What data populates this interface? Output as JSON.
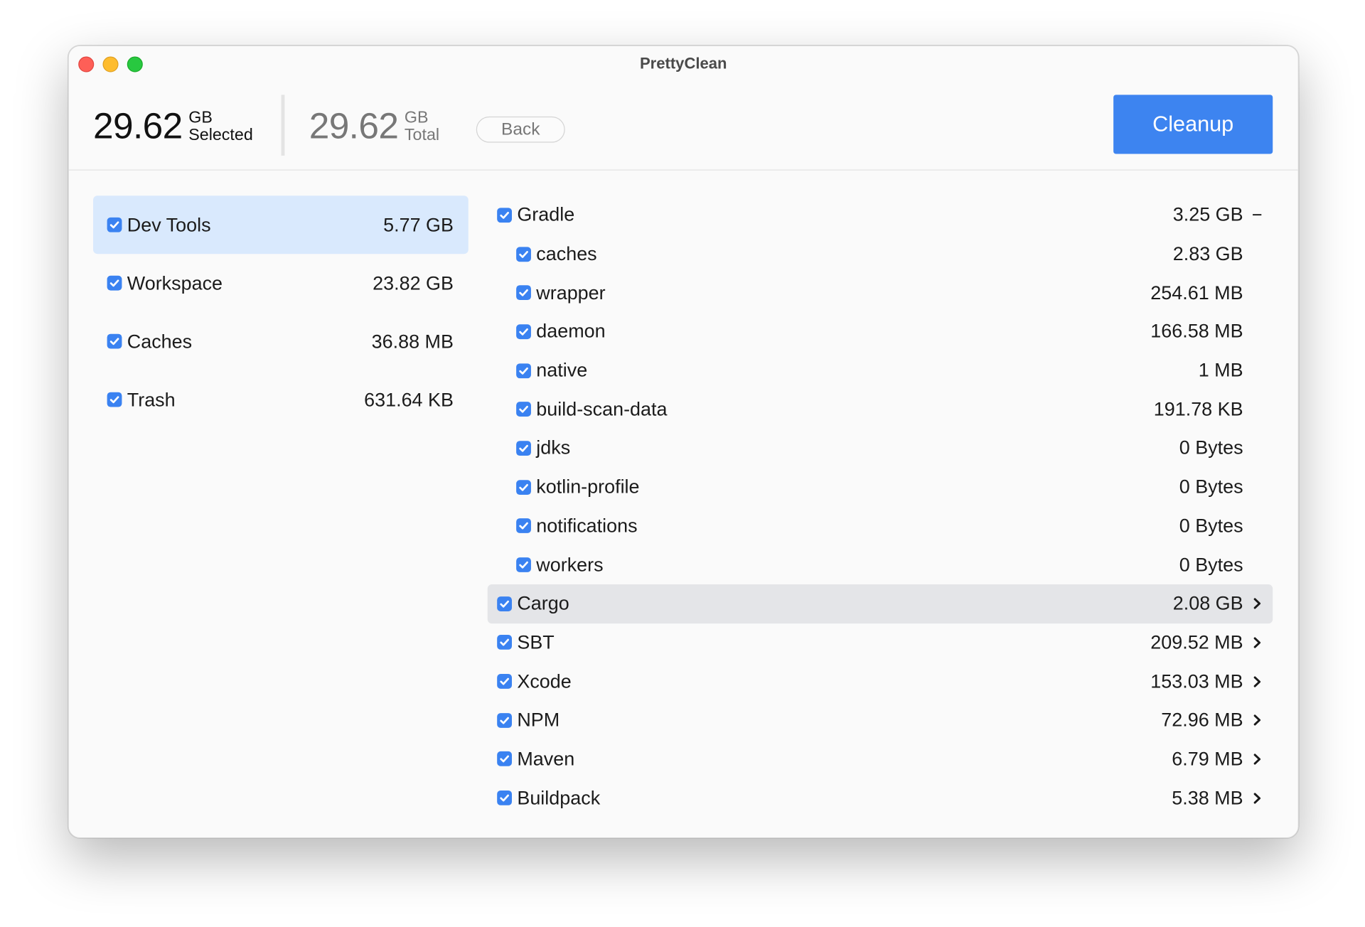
{
  "window": {
    "title": "PrettyClean"
  },
  "header": {
    "selected": {
      "value": "29.62",
      "unit": "GB",
      "caption": "Selected"
    },
    "total": {
      "value": "29.62",
      "unit": "GB",
      "caption": "Total"
    },
    "back_label": "Back",
    "cleanup_label": "Cleanup"
  },
  "categories": [
    {
      "label": "Dev Tools",
      "size": "5.77 GB",
      "checked": true,
      "active": true
    },
    {
      "label": "Workspace",
      "size": "23.82 GB",
      "checked": true,
      "active": false
    },
    {
      "label": "Caches",
      "size": "36.88 MB",
      "checked": true,
      "active": false
    },
    {
      "label": "Trash",
      "size": "631.64 KB",
      "checked": true,
      "active": false
    }
  ],
  "tools": [
    {
      "label": "Gradle",
      "size": "3.25 GB",
      "level": 0,
      "checked": true,
      "trail": "collapse-icon"
    },
    {
      "label": "caches",
      "size": "2.83 GB",
      "level": 1,
      "checked": true
    },
    {
      "label": "wrapper",
      "size": "254.61 MB",
      "level": 1,
      "checked": true
    },
    {
      "label": "daemon",
      "size": "166.58 MB",
      "level": 1,
      "checked": true
    },
    {
      "label": "native",
      "size": "1 MB",
      "level": 1,
      "checked": true
    },
    {
      "label": "build-scan-data",
      "size": "191.78 KB",
      "level": 1,
      "checked": true
    },
    {
      "label": "jdks",
      "size": "0 Bytes",
      "level": 1,
      "checked": true
    },
    {
      "label": "kotlin-profile",
      "size": "0 Bytes",
      "level": 1,
      "checked": true
    },
    {
      "label": "notifications",
      "size": "0 Bytes",
      "level": 1,
      "checked": true
    },
    {
      "label": "workers",
      "size": "0 Bytes",
      "level": 1,
      "checked": true
    },
    {
      "label": "Cargo",
      "size": "2.08 GB",
      "level": 0,
      "checked": true,
      "trail": "chevron-right-icon",
      "highlight": true
    },
    {
      "label": "SBT",
      "size": "209.52 MB",
      "level": 0,
      "checked": true,
      "trail": "chevron-right-icon"
    },
    {
      "label": "Xcode",
      "size": "153.03 MB",
      "level": 0,
      "checked": true,
      "trail": "chevron-right-icon"
    },
    {
      "label": "NPM",
      "size": "72.96 MB",
      "level": 0,
      "checked": true,
      "trail": "chevron-right-icon"
    },
    {
      "label": "Maven",
      "size": "6.79 MB",
      "level": 0,
      "checked": true,
      "trail": "chevron-right-icon"
    },
    {
      "label": "Buildpack",
      "size": "5.38 MB",
      "level": 0,
      "checked": true,
      "trail": "chevron-right-icon"
    }
  ],
  "colors": {
    "accent": "#3d84f0",
    "checkbox": "#3a82f1",
    "active_category": "#d9e9fd",
    "hover_row": "#e4e5e8"
  }
}
